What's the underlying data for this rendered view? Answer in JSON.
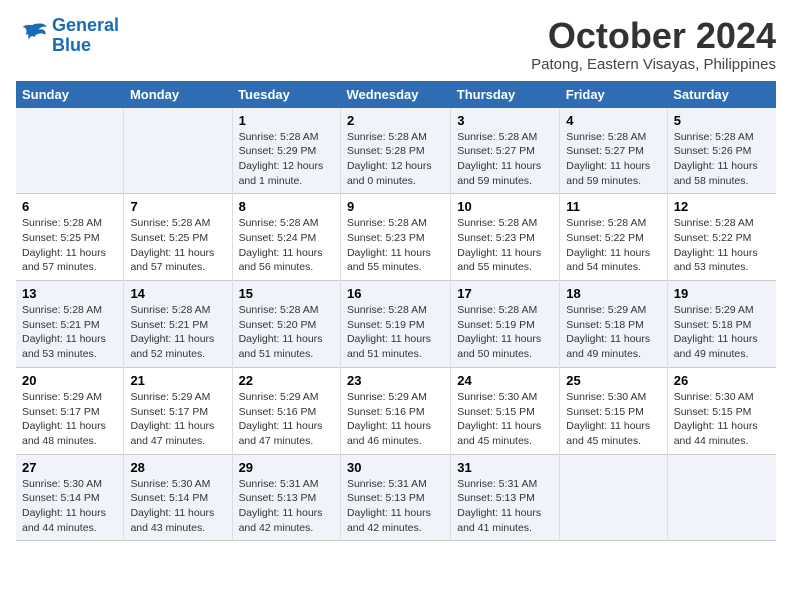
{
  "logo": {
    "line1": "General",
    "line2": "Blue"
  },
  "title": "October 2024",
  "subtitle": "Patong, Eastern Visayas, Philippines",
  "header_days": [
    "Sunday",
    "Monday",
    "Tuesday",
    "Wednesday",
    "Thursday",
    "Friday",
    "Saturday"
  ],
  "weeks": [
    [
      {
        "day": "",
        "sunrise": "",
        "sunset": "",
        "daylight": ""
      },
      {
        "day": "",
        "sunrise": "",
        "sunset": "",
        "daylight": ""
      },
      {
        "day": "1",
        "sunrise": "Sunrise: 5:28 AM",
        "sunset": "Sunset: 5:29 PM",
        "daylight": "Daylight: 12 hours and 1 minute."
      },
      {
        "day": "2",
        "sunrise": "Sunrise: 5:28 AM",
        "sunset": "Sunset: 5:28 PM",
        "daylight": "Daylight: 12 hours and 0 minutes."
      },
      {
        "day": "3",
        "sunrise": "Sunrise: 5:28 AM",
        "sunset": "Sunset: 5:27 PM",
        "daylight": "Daylight: 11 hours and 59 minutes."
      },
      {
        "day": "4",
        "sunrise": "Sunrise: 5:28 AM",
        "sunset": "Sunset: 5:27 PM",
        "daylight": "Daylight: 11 hours and 59 minutes."
      },
      {
        "day": "5",
        "sunrise": "Sunrise: 5:28 AM",
        "sunset": "Sunset: 5:26 PM",
        "daylight": "Daylight: 11 hours and 58 minutes."
      }
    ],
    [
      {
        "day": "6",
        "sunrise": "Sunrise: 5:28 AM",
        "sunset": "Sunset: 5:25 PM",
        "daylight": "Daylight: 11 hours and 57 minutes."
      },
      {
        "day": "7",
        "sunrise": "Sunrise: 5:28 AM",
        "sunset": "Sunset: 5:25 PM",
        "daylight": "Daylight: 11 hours and 57 minutes."
      },
      {
        "day": "8",
        "sunrise": "Sunrise: 5:28 AM",
        "sunset": "Sunset: 5:24 PM",
        "daylight": "Daylight: 11 hours and 56 minutes."
      },
      {
        "day": "9",
        "sunrise": "Sunrise: 5:28 AM",
        "sunset": "Sunset: 5:23 PM",
        "daylight": "Daylight: 11 hours and 55 minutes."
      },
      {
        "day": "10",
        "sunrise": "Sunrise: 5:28 AM",
        "sunset": "Sunset: 5:23 PM",
        "daylight": "Daylight: 11 hours and 55 minutes."
      },
      {
        "day": "11",
        "sunrise": "Sunrise: 5:28 AM",
        "sunset": "Sunset: 5:22 PM",
        "daylight": "Daylight: 11 hours and 54 minutes."
      },
      {
        "day": "12",
        "sunrise": "Sunrise: 5:28 AM",
        "sunset": "Sunset: 5:22 PM",
        "daylight": "Daylight: 11 hours and 53 minutes."
      }
    ],
    [
      {
        "day": "13",
        "sunrise": "Sunrise: 5:28 AM",
        "sunset": "Sunset: 5:21 PM",
        "daylight": "Daylight: 11 hours and 53 minutes."
      },
      {
        "day": "14",
        "sunrise": "Sunrise: 5:28 AM",
        "sunset": "Sunset: 5:21 PM",
        "daylight": "Daylight: 11 hours and 52 minutes."
      },
      {
        "day": "15",
        "sunrise": "Sunrise: 5:28 AM",
        "sunset": "Sunset: 5:20 PM",
        "daylight": "Daylight: 11 hours and 51 minutes."
      },
      {
        "day": "16",
        "sunrise": "Sunrise: 5:28 AM",
        "sunset": "Sunset: 5:19 PM",
        "daylight": "Daylight: 11 hours and 51 minutes."
      },
      {
        "day": "17",
        "sunrise": "Sunrise: 5:28 AM",
        "sunset": "Sunset: 5:19 PM",
        "daylight": "Daylight: 11 hours and 50 minutes."
      },
      {
        "day": "18",
        "sunrise": "Sunrise: 5:29 AM",
        "sunset": "Sunset: 5:18 PM",
        "daylight": "Daylight: 11 hours and 49 minutes."
      },
      {
        "day": "19",
        "sunrise": "Sunrise: 5:29 AM",
        "sunset": "Sunset: 5:18 PM",
        "daylight": "Daylight: 11 hours and 49 minutes."
      }
    ],
    [
      {
        "day": "20",
        "sunrise": "Sunrise: 5:29 AM",
        "sunset": "Sunset: 5:17 PM",
        "daylight": "Daylight: 11 hours and 48 minutes."
      },
      {
        "day": "21",
        "sunrise": "Sunrise: 5:29 AM",
        "sunset": "Sunset: 5:17 PM",
        "daylight": "Daylight: 11 hours and 47 minutes."
      },
      {
        "day": "22",
        "sunrise": "Sunrise: 5:29 AM",
        "sunset": "Sunset: 5:16 PM",
        "daylight": "Daylight: 11 hours and 47 minutes."
      },
      {
        "day": "23",
        "sunrise": "Sunrise: 5:29 AM",
        "sunset": "Sunset: 5:16 PM",
        "daylight": "Daylight: 11 hours and 46 minutes."
      },
      {
        "day": "24",
        "sunrise": "Sunrise: 5:30 AM",
        "sunset": "Sunset: 5:15 PM",
        "daylight": "Daylight: 11 hours and 45 minutes."
      },
      {
        "day": "25",
        "sunrise": "Sunrise: 5:30 AM",
        "sunset": "Sunset: 5:15 PM",
        "daylight": "Daylight: 11 hours and 45 minutes."
      },
      {
        "day": "26",
        "sunrise": "Sunrise: 5:30 AM",
        "sunset": "Sunset: 5:15 PM",
        "daylight": "Daylight: 11 hours and 44 minutes."
      }
    ],
    [
      {
        "day": "27",
        "sunrise": "Sunrise: 5:30 AM",
        "sunset": "Sunset: 5:14 PM",
        "daylight": "Daylight: 11 hours and 44 minutes."
      },
      {
        "day": "28",
        "sunrise": "Sunrise: 5:30 AM",
        "sunset": "Sunset: 5:14 PM",
        "daylight": "Daylight: 11 hours and 43 minutes."
      },
      {
        "day": "29",
        "sunrise": "Sunrise: 5:31 AM",
        "sunset": "Sunset: 5:13 PM",
        "daylight": "Daylight: 11 hours and 42 minutes."
      },
      {
        "day": "30",
        "sunrise": "Sunrise: 5:31 AM",
        "sunset": "Sunset: 5:13 PM",
        "daylight": "Daylight: 11 hours and 42 minutes."
      },
      {
        "day": "31",
        "sunrise": "Sunrise: 5:31 AM",
        "sunset": "Sunset: 5:13 PM",
        "daylight": "Daylight: 11 hours and 41 minutes."
      },
      {
        "day": "",
        "sunrise": "",
        "sunset": "",
        "daylight": ""
      },
      {
        "day": "",
        "sunrise": "",
        "sunset": "",
        "daylight": ""
      }
    ]
  ]
}
